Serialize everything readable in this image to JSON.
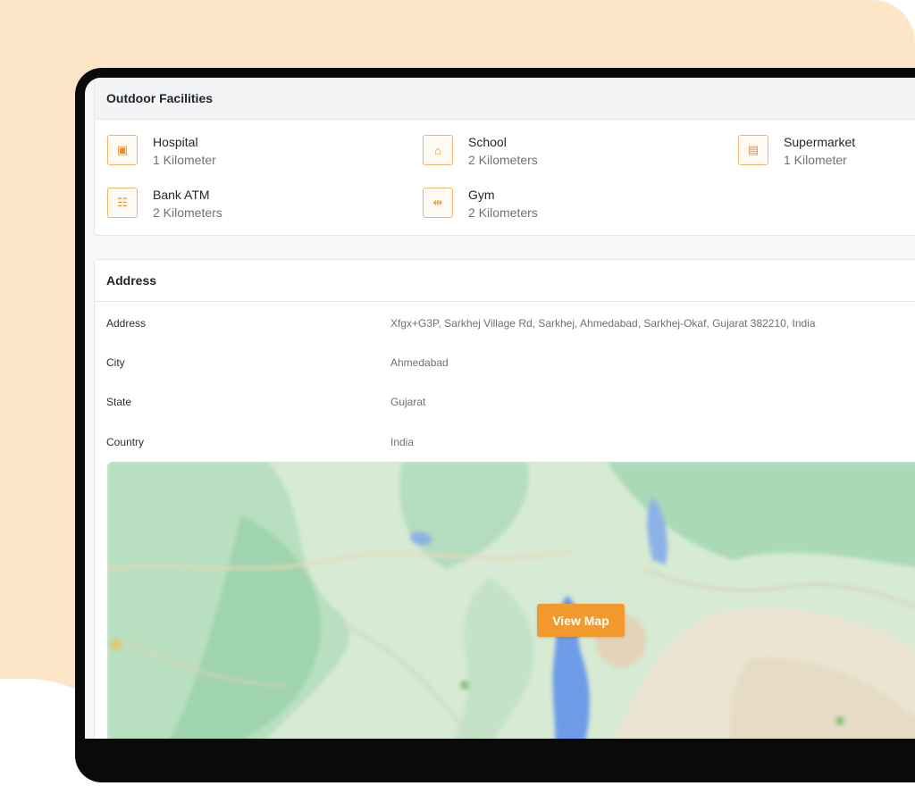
{
  "outdoor": {
    "title": "Outdoor Facilities",
    "items": [
      {
        "name": "Hospital",
        "distance": "1 Kilometer",
        "icon": "hospital-icon",
        "glyph": "▣"
      },
      {
        "name": "School",
        "distance": "2 Kilometers",
        "icon": "school-icon",
        "glyph": "⌂"
      },
      {
        "name": "Supermarket",
        "distance": "1 Kilometer",
        "icon": "supermarket-icon",
        "glyph": "▤"
      },
      {
        "name": "Bank ATM",
        "distance": "2 Kilometers",
        "icon": "atm-icon",
        "glyph": "☷"
      },
      {
        "name": "Gym",
        "distance": "2 Kilometers",
        "icon": "gym-icon",
        "glyph": "⇹"
      }
    ]
  },
  "address": {
    "title": "Address",
    "rows": [
      {
        "label": "Address",
        "value": "Xfgx+G3P, Sarkhej Village Rd, Sarkhej, Ahmedabad, Sarkhej-Okaf, Gujarat 382210, India"
      },
      {
        "label": "City",
        "value": "Ahmedabad"
      },
      {
        "label": "State",
        "value": "Gujarat"
      },
      {
        "label": "Country",
        "value": "India"
      }
    ],
    "map_button": "View Map"
  },
  "colors": {
    "accent": "#f29a2e",
    "background_peach": "#fde5c8",
    "icon_border": "#f0b46a"
  }
}
